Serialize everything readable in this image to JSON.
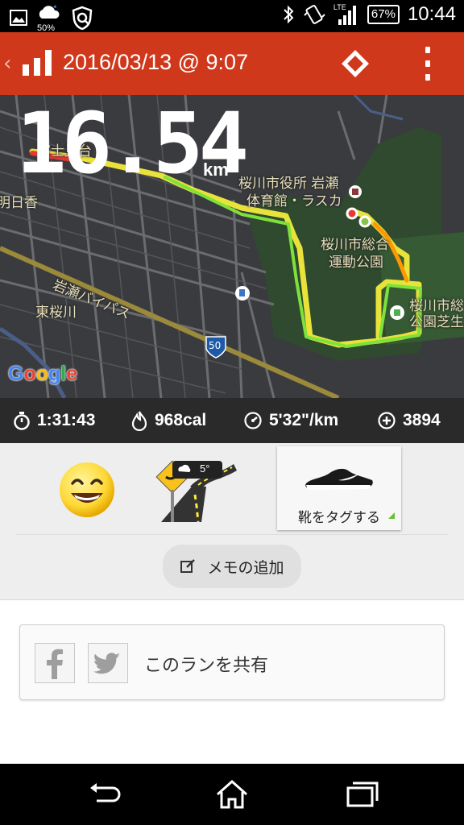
{
  "status_bar": {
    "battery_saver_pct": "50%",
    "network": "LTE",
    "battery": "67%",
    "time": "10:44",
    "icons": [
      "image-icon",
      "weather-cloud-icon",
      "shield-icon",
      "bluetooth-icon",
      "vibrate-icon",
      "signal-icon",
      "battery-icon"
    ]
  },
  "app_bar": {
    "title": "2016/03/13 @ 9:07",
    "back_icon": "chevron-left-icon",
    "logo_icon": "bar-chart-icon",
    "action_icon": "diamond-icon",
    "menu_icon": "overflow-menu-icon",
    "accent": "#d0381c"
  },
  "map": {
    "distance": "16.54",
    "unit": "km",
    "labels": {
      "fujimidai": "富士見台",
      "asuka": "明日香",
      "shiyakusho_line1": "桜川市役所 岩瀬",
      "shiyakusho_line2": "体育館・ラスカ",
      "sogo_line1": "桜川市総合",
      "sogo_line2": "運動公園",
      "shiba_line1": "桜川市総",
      "shiba_line2": "公園芝生",
      "bypass": "岩瀬バイパス",
      "higashi": "東桜川",
      "route": "50"
    },
    "attribution": "Google",
    "route_colors": [
      "#e53935",
      "#ffeb3b",
      "#c6e62b",
      "#66dd22"
    ]
  },
  "stats": {
    "duration": "1:31:43",
    "calories": "968cal",
    "pace": "5'32\"/km",
    "fuel": "3894",
    "icons": [
      "stopwatch-icon",
      "flame-icon",
      "speedometer-icon",
      "fuel-plus-icon"
    ]
  },
  "tags": {
    "mood_icon": "smiley-face-icon",
    "weather_temp": "5°",
    "weather_icon": "road-weather-icon",
    "shoe_label": "靴をタグする",
    "shoe_icon": "sneaker-icon",
    "memo_label": "メモの追加",
    "memo_icon": "edit-note-icon"
  },
  "share": {
    "label": "このランを共有",
    "icons": [
      "facebook-icon",
      "twitter-icon"
    ]
  },
  "nav_bar": {
    "icons": [
      "back-icon",
      "home-icon",
      "recents-icon"
    ]
  }
}
